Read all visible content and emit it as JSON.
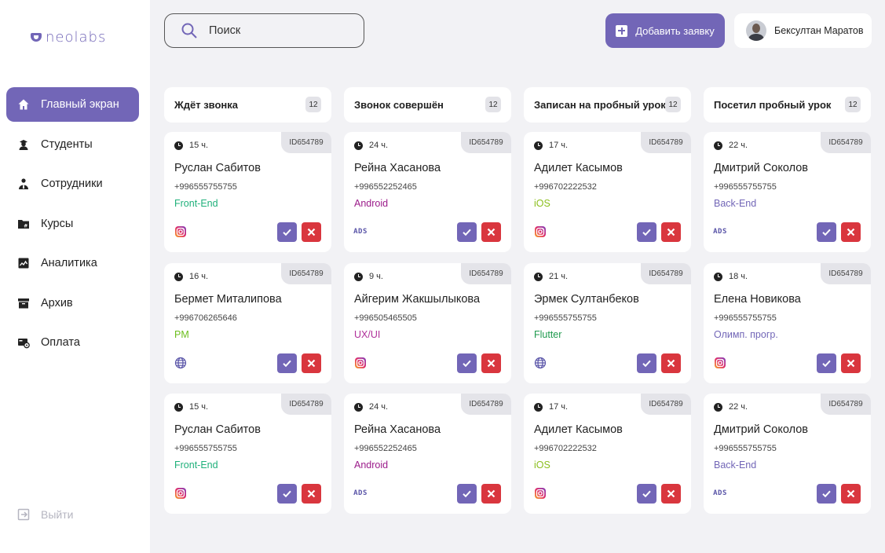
{
  "app": {
    "logo_text": "neolabs"
  },
  "sidebar": {
    "items": [
      {
        "label": "Главный экран",
        "icon": "home-icon",
        "active": true
      },
      {
        "label": "Студенты",
        "icon": "student-icon",
        "active": false
      },
      {
        "label": "Сотрудники",
        "icon": "staff-icon",
        "active": false
      },
      {
        "label": "Курсы",
        "icon": "folder-hash-icon",
        "active": false
      },
      {
        "label": "Аналитика",
        "icon": "analytics-icon",
        "active": false
      },
      {
        "label": "Архив",
        "icon": "archive-icon",
        "active": false
      },
      {
        "label": "Оплата",
        "icon": "payment-icon",
        "active": false
      }
    ],
    "logout_label": "Выйти"
  },
  "header": {
    "search_placeholder": "Поиск",
    "add_button_label": "Добавить заявку",
    "user_name": "Бексултан Маратов"
  },
  "colors": {
    "accent": "#7266b7",
    "danger": "#d9363e",
    "tag_frontend": "#1fb07a",
    "tag_android": "#9b1b8a",
    "tag_ios": "#8bbf1d",
    "tag_backend": "#7266b7",
    "tag_pm": "#6cbf1d",
    "tag_uxui": "#b0309a",
    "tag_flutter": "#1f9a4e",
    "tag_olymp": "#7266b7"
  },
  "columns": [
    {
      "title": "Ждёт звонка",
      "count": "12",
      "cards": [
        {
          "time": "15 ч.",
          "id": "ID654789",
          "name": "Руслан Сабитов",
          "phone": "+996555755755",
          "tag": "Front-End",
          "tag_color": "#1fb07a",
          "source": "instagram"
        },
        {
          "time": "16 ч.",
          "id": "ID654789",
          "name": "Бермет Миталипова",
          "phone": "+996706265646",
          "tag": "PM",
          "tag_color": "#6cbf1d",
          "source": "web"
        },
        {
          "time": "15 ч.",
          "id": "ID654789",
          "name": "Руслан Сабитов",
          "phone": "+996555755755",
          "tag": "Front-End",
          "tag_color": "#1fb07a",
          "source": "instagram"
        }
      ]
    },
    {
      "title": "Звонок совершён",
      "count": "12",
      "cards": [
        {
          "time": "24 ч.",
          "id": "ID654789",
          "name": "Рейна Хасанова",
          "phone": "+996552252465",
          "tag": "Android",
          "tag_color": "#9b1b8a",
          "source": "ads"
        },
        {
          "time": "9 ч.",
          "id": "ID654789",
          "name": "Айгерим Жакшылыкова",
          "phone": "+996505465505",
          "tag": "UX/UI",
          "tag_color": "#b0309a",
          "source": "instagram"
        },
        {
          "time": "24 ч.",
          "id": "ID654789",
          "name": "Рейна Хасанова",
          "phone": "+996552252465",
          "tag": "Android",
          "tag_color": "#9b1b8a",
          "source": "ads"
        }
      ]
    },
    {
      "title": "Записан на пробный урок",
      "count": "12",
      "cards": [
        {
          "time": "17 ч.",
          "id": "ID654789",
          "name": "Адилет Касымов",
          "phone": "+996702222532",
          "tag": "iOS",
          "tag_color": "#8bbf1d",
          "source": "instagram"
        },
        {
          "time": "21 ч.",
          "id": "ID654789",
          "name": "Эрмек Султанбеков",
          "phone": "+996555755755",
          "tag": "Flutter",
          "tag_color": "#1f9a4e",
          "source": "web"
        },
        {
          "time": "17 ч.",
          "id": "ID654789",
          "name": "Адилет Касымов",
          "phone": "+996702222532",
          "tag": "iOS",
          "tag_color": "#8bbf1d",
          "source": "instagram"
        }
      ]
    },
    {
      "title": "Посетил пробный урок",
      "count": "12",
      "cards": [
        {
          "time": "22 ч.",
          "id": "ID654789",
          "name": "Дмитрий Соколов",
          "phone": "+996555755755",
          "tag": "Back-End",
          "tag_color": "#7266b7",
          "source": "ads"
        },
        {
          "time": "18 ч.",
          "id": "ID654789",
          "name": "Елена Новикова",
          "phone": "+996555755755",
          "tag": "Олимп. прогр.",
          "tag_color": "#7266b7",
          "source": "instagram"
        },
        {
          "time": "22 ч.",
          "id": "ID654789",
          "name": "Дмитрий Соколов",
          "phone": "+996555755755",
          "tag": "Back-End",
          "tag_color": "#7266b7",
          "source": "ads"
        }
      ]
    }
  ],
  "ads_label": "ADS"
}
